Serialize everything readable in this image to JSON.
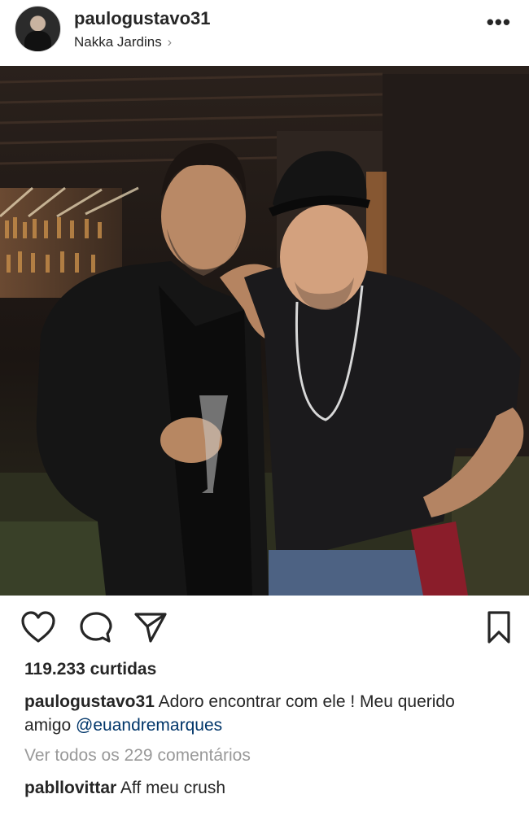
{
  "post": {
    "username": "paulogustavo31",
    "location": "Nakka Jardins",
    "location_chevron": "›",
    "more_icon": "•••"
  },
  "photo": {
    "description_icon": "photo-of-two-men"
  },
  "actions": {
    "like_icon": "heart-icon",
    "comment_icon": "comment-icon",
    "share_icon": "send-icon",
    "save_icon": "bookmark-icon"
  },
  "likes_text": "119.233 curtidas",
  "caption": {
    "username": "paulogustavo31",
    "text": "Adoro encontrar com ele ! Meu querido amigo",
    "mention": "@euandremarques"
  },
  "view_all_comments": "Ver todos os 229 comentários",
  "comment": {
    "username": "pabllovittar",
    "text": "Aff meu crush"
  },
  "colors": {
    "text": "#262626",
    "muted": "#999999",
    "link": "#003569"
  }
}
